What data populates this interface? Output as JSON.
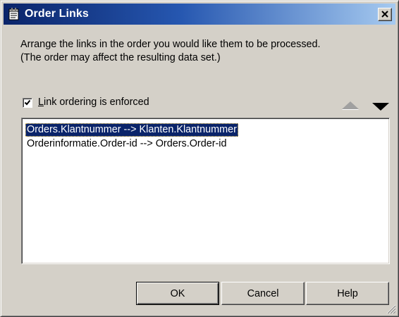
{
  "window": {
    "title": "Order Links",
    "icon": "notepad-icon",
    "close_label": "×"
  },
  "instructions": {
    "line1": "Arrange the links in the order you would like them to be processed.",
    "line2": "(The order may affect the resulting data set.)"
  },
  "enforce": {
    "checked": true,
    "label_accel": "L",
    "label_rest": "ink ordering is enforced"
  },
  "move_buttons": {
    "up_icon": "triangle-up-icon",
    "down_icon": "triangle-down-icon",
    "up_enabled": false,
    "down_enabled": true
  },
  "links": [
    {
      "text": "Orders.Klantnummer --> Klanten.Klantnummer",
      "selected": true
    },
    {
      "text": "Orderinformatie.Order-id --> Orders.Order-id",
      "selected": false
    }
  ],
  "buttons": {
    "ok": "OK",
    "cancel": "Cancel",
    "help": "Help"
  },
  "colors": {
    "title_start": "#0a246a",
    "title_end": "#a6caf0",
    "selection": "#0a246a",
    "face": "#d4d0c8"
  }
}
